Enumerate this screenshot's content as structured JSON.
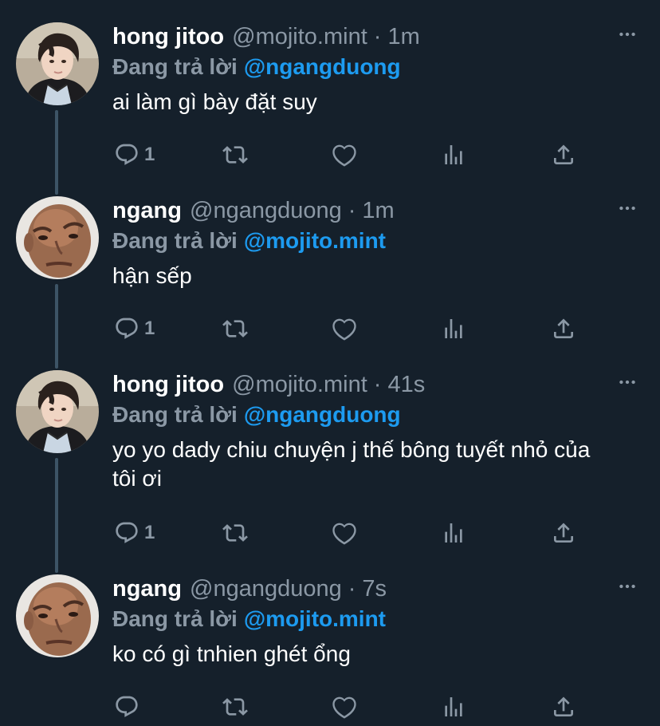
{
  "colors": {
    "background": "#15202b",
    "secondary_text": "#8b98a5",
    "link": "#1d9bf0",
    "thread_line": "#3d5466"
  },
  "icons": {
    "more": "more-horizontal-icon",
    "reply": "reply-icon",
    "retweet": "retweet-icon",
    "like": "like-icon",
    "analytics": "analytics-icon",
    "share": "share-icon"
  },
  "tweets": [
    {
      "name": "hong jitoo",
      "handle": "@mojito.mint",
      "separator": "·",
      "time": "1m",
      "reply_prefix": "Đang trả lời",
      "reply_to": "@ngangduong",
      "text": "ai làm gì bày đặt suy",
      "reply_count": "1"
    },
    {
      "name": "ngang",
      "handle": "@ngangduong",
      "separator": "·",
      "time": "1m",
      "reply_prefix": "Đang trả lời",
      "reply_to": "@mojito.mint",
      "text": "hận sếp",
      "reply_count": "1"
    },
    {
      "name": "hong jitoo",
      "handle": "@mojito.mint",
      "separator": "·",
      "time": "41s",
      "reply_prefix": "Đang trả lời",
      "reply_to": "@ngangduong",
      "text": "yo yo dady chiu chuyện j thế bông tuyết nhỏ của tôi ơi",
      "reply_count": "1"
    },
    {
      "name": "ngang",
      "handle": "@ngangduong",
      "separator": "·",
      "time": "7s",
      "reply_prefix": "Đang trả lời",
      "reply_to": "@mojito.mint",
      "text": "ko có gì tnhien ghét ổng",
      "reply_count": ""
    }
  ]
}
